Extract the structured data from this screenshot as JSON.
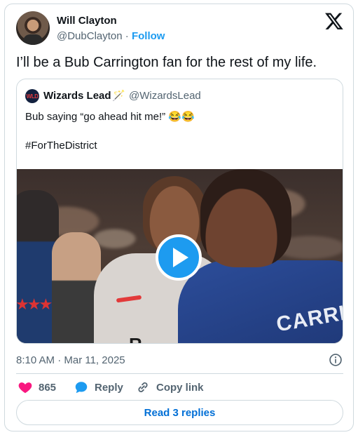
{
  "author": {
    "name": "Will Clayton",
    "handle": "@DubClayton",
    "separator": "·",
    "follow_label": "Follow"
  },
  "tweet": {
    "text": "I’ll be a Bub Carrington fan for the rest of my life."
  },
  "quoted": {
    "avatar_text": "WLD",
    "name": "Wizards Lead",
    "name_emoji": "🪄",
    "handle": "@WizardsLead",
    "text": "Bub saying “go ahead hit me!” 😂😂",
    "hashtag": "#ForTheDistrict",
    "media": {
      "jersey_letter": "R",
      "jersey_name": "CARRIN",
      "stars": "★★★"
    }
  },
  "meta": {
    "timestamp": "8:10 AM · Mar 11, 2025"
  },
  "actions": {
    "like_count": "865",
    "reply_label": "Reply",
    "copy_label": "Copy link"
  },
  "read_replies_label": "Read 3 replies",
  "colors": {
    "accent": "#1d9bf0",
    "like": "#f91880",
    "link": "#006fd6",
    "muted": "#536471"
  },
  "icons": [
    "x-logo-icon",
    "info-icon",
    "heart-icon",
    "reply-bubble-icon",
    "link-icon",
    "play-icon"
  ]
}
